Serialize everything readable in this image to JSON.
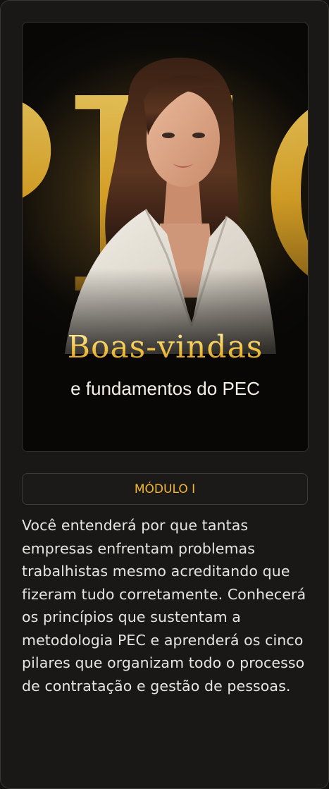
{
  "banner": {
    "title": "Boas-vindas",
    "subtitle": "e fundamentos do PEC",
    "background_letters": "PEC",
    "accent_color": "#f2c94c"
  },
  "module": {
    "label": "MÓDULO I",
    "color": "#f2b632"
  },
  "description": "Você entenderá por que tantas empresas enfrentam problemas trabalhistas mesmo acreditando que fizeram tudo corretamente. Conhecerá os princípios que sustentam a metodologia PEC e aprenderá os cinco pilares que organizam todo o processo de contratação e gestão de pessoas."
}
